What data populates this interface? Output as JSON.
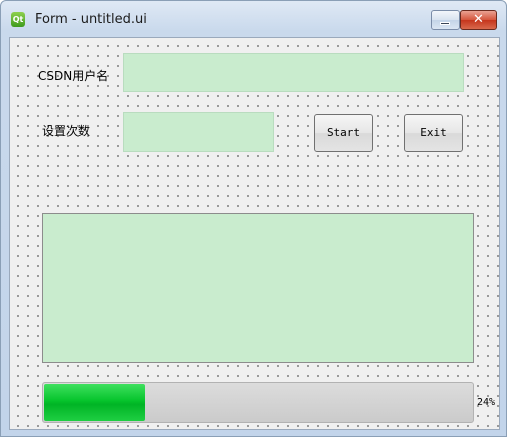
{
  "window": {
    "title": "Form - untitled.ui",
    "app_icon_text": "Qt",
    "close_glyph": "✕"
  },
  "form": {
    "username_label": "CSDN用户名",
    "username_value": "",
    "count_label": "设置次数",
    "count_value": "",
    "start_label": "Start",
    "exit_label": "Exit",
    "log_text": ""
  },
  "progress": {
    "value": 24,
    "text": "24%"
  },
  "colors": {
    "field_bg": "#c9ecce",
    "progress_fill": "#06c42c"
  }
}
